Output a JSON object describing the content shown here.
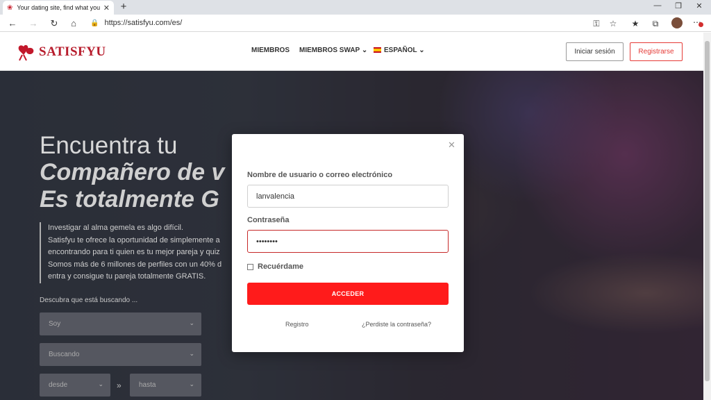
{
  "browser": {
    "tab_title": "Your dating site, find what you a",
    "url": "https://satisfyu.com/es/"
  },
  "header": {
    "logo_text": "SATISFYU",
    "menu": [
      "MIEMBROS",
      "MIEMBROS SWAP",
      "ESPAÑOL"
    ],
    "login_label": "Iniciar sesión",
    "register_label": "Registrarse"
  },
  "hero": {
    "line1": "Encuentra tu",
    "line2": "Compañero de v",
    "line3": "Es totalmente G",
    "paragraph": [
      "Investigar al alma gemela es algo difícil.",
      "Satisfyu te ofrece la oportunidad de simplemente a",
      "encontrando para ti quien es tu mejor pareja y quiz",
      "Somos más de 6 millones de perfiles con un 40% d",
      "entra y consigue tu pareja totalmente GRATIS."
    ],
    "discover_label": "Descubra que está buscando ...",
    "select_soy": "Soy",
    "select_buscando": "Buscando",
    "select_desde": "desde",
    "select_hasta": "hasta"
  },
  "modal": {
    "username_label": "Nombre de usuario o correo electrónico",
    "username_value": "lanvalencia",
    "password_label": "Contraseña",
    "password_value": "••••••••",
    "remember_label": "Recuérdame",
    "submit_label": "ACCEDER",
    "register_link": "Registro",
    "forgot_link": "¿Perdiste la contraseña?"
  },
  "colors": {
    "brand": "#b71c2c",
    "primary_button": "#ff1b1b"
  }
}
